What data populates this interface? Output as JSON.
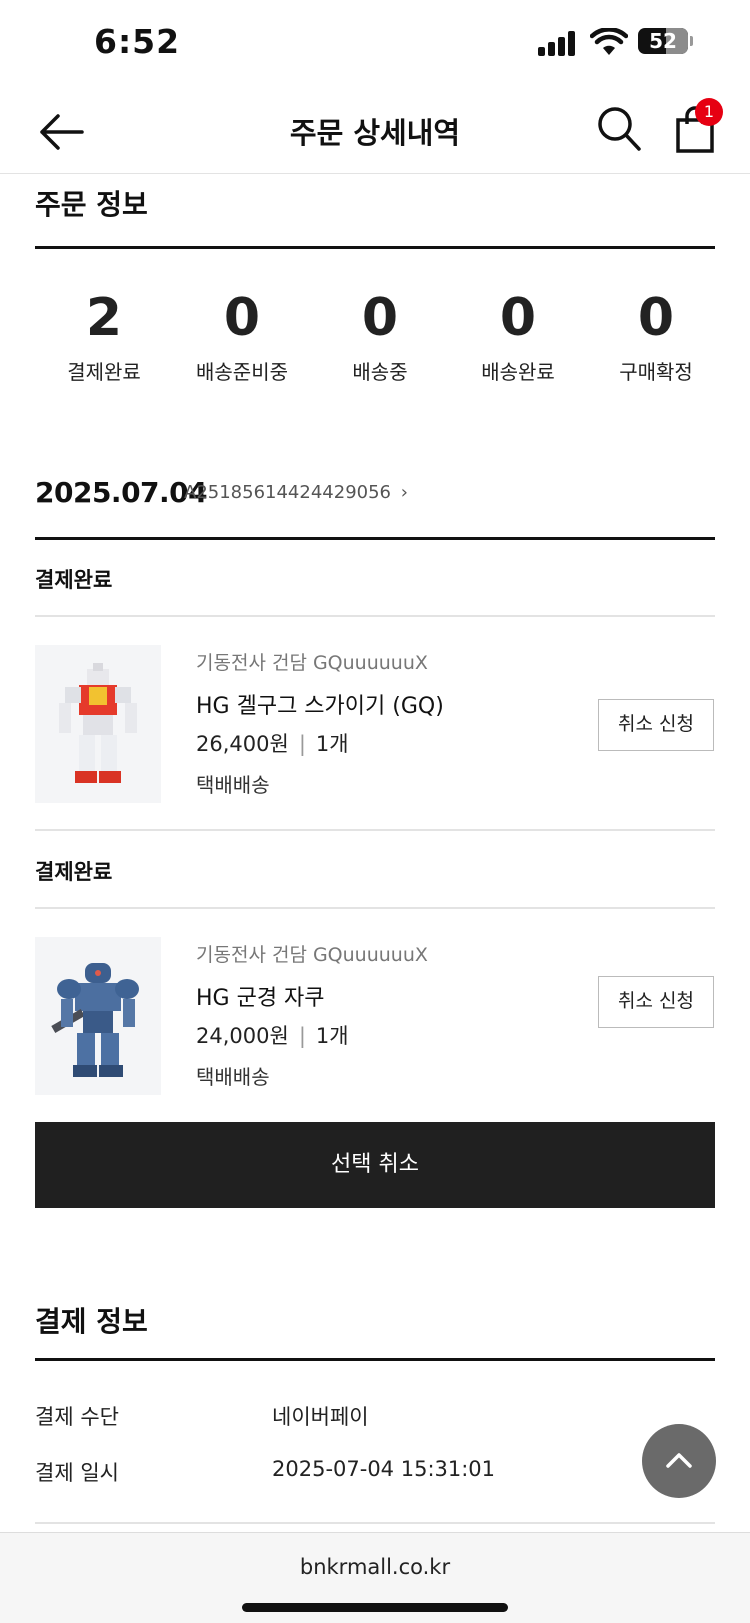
{
  "status_bar": {
    "time": "6:52",
    "battery": "52"
  },
  "header": {
    "title": "주문 상세내역",
    "cart_count": "1"
  },
  "order_info": {
    "title": "주문 정보",
    "counts": [
      {
        "label": "결제완료",
        "value": "2"
      },
      {
        "label": "배송준비중",
        "value": "0"
      },
      {
        "label": "배송중",
        "value": "0"
      },
      {
        "label": "배송완료",
        "value": "0"
      },
      {
        "label": "구매확정",
        "value": "0"
      }
    ]
  },
  "order": {
    "date": "2025.07.04",
    "number": "A25185614424429056",
    "items": [
      {
        "status": "결제완료",
        "brand": "기동전사 건담 GQuuuuuuX",
        "name": "HG 겔구그 스가이기 (GQ)",
        "price": "26,400원",
        "qty": "1개",
        "shipping": "택배배송",
        "cancel_label": "취소 신청"
      },
      {
        "status": "결제완료",
        "brand": "기동전사 건담 GQuuuuuuX",
        "name": "HG 군경 자쿠",
        "price": "24,000원",
        "qty": "1개",
        "shipping": "택배배송",
        "cancel_label": "취소 신청"
      }
    ],
    "bulk_cancel_label": "선택 취소"
  },
  "payment": {
    "title": "결제 정보",
    "rows": [
      {
        "label": "결제 수단",
        "value": "네이버페이"
      },
      {
        "label": "결제 일시",
        "value": "2025-07-04 15:31:01"
      }
    ]
  },
  "footer": {
    "url": "bnkrmall.co.kr"
  }
}
